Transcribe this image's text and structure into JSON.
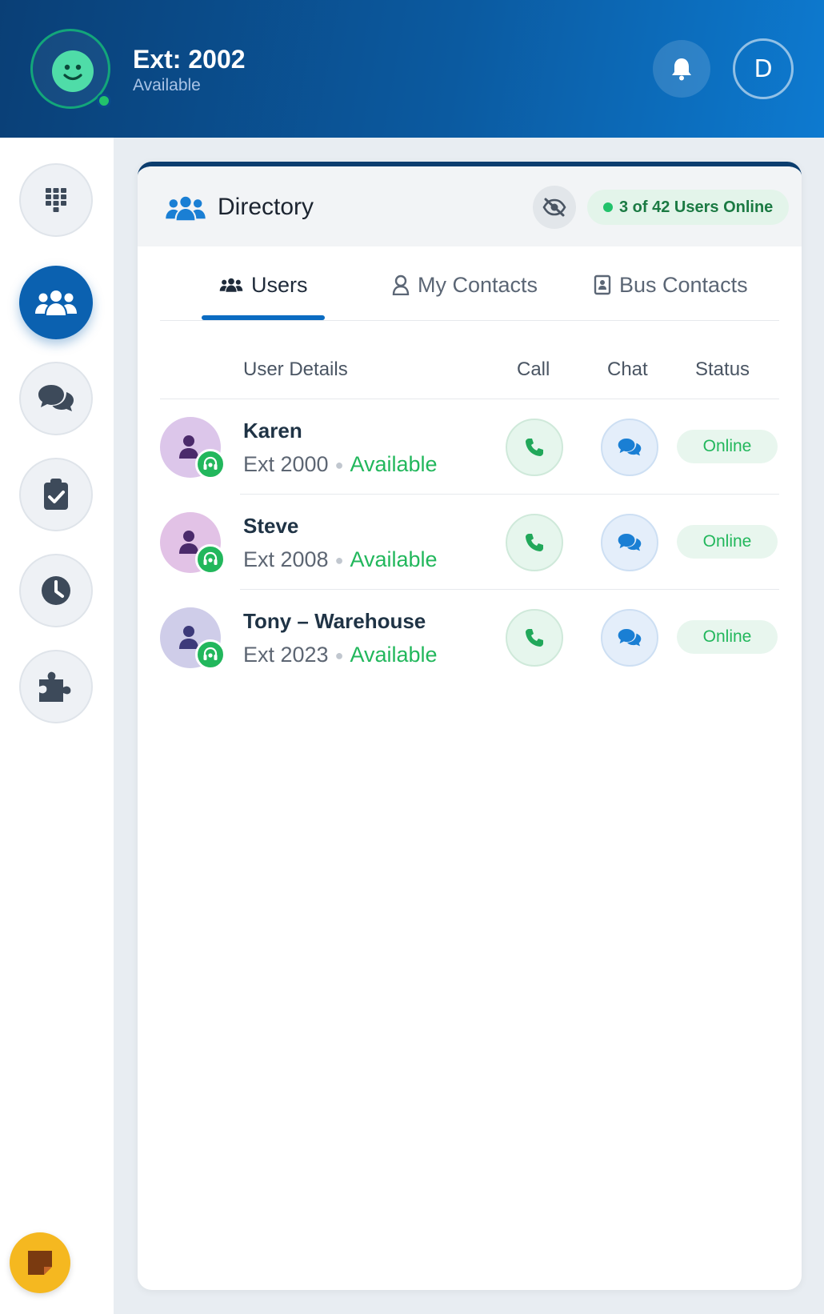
{
  "header": {
    "extension": "Ext: 2002",
    "presence": "Available",
    "avatar_initial": "D",
    "brand_color": "#0b5aa0"
  },
  "sidebar": {
    "items": [
      {
        "name": "dialpad",
        "icon": "dialpad-icon"
      },
      {
        "name": "directory",
        "icon": "users-icon",
        "active": true
      },
      {
        "name": "chat",
        "icon": "chat-bubbles-icon"
      },
      {
        "name": "tasks",
        "icon": "clipboard-check-icon"
      },
      {
        "name": "history",
        "icon": "clock-icon"
      },
      {
        "name": "integrations",
        "icon": "puzzle-icon"
      }
    ],
    "sticky_note_icon": "sticky-note-icon"
  },
  "directory": {
    "title": "Directory",
    "online_summary": "3 of 42 Users Online",
    "tabs": [
      {
        "label": "Users",
        "active": true
      },
      {
        "label": "My Contacts",
        "active": false
      },
      {
        "label": "Bus Contacts",
        "active": false
      }
    ],
    "columns": {
      "user_details": "User Details",
      "call": "Call",
      "chat": "Chat",
      "status": "Status"
    },
    "users": [
      {
        "name": "Karen",
        "ext": "Ext 2000",
        "presence": "Available",
        "status": "Online",
        "avatar_color": "#dcc6ea"
      },
      {
        "name": "Steve",
        "ext": "Ext 2008",
        "presence": "Available",
        "status": "Online",
        "avatar_color": "#e2c2e6"
      },
      {
        "name": "Tony – Warehouse",
        "ext": "Ext 2023",
        "presence": "Available",
        "status": "Online",
        "avatar_color": "#cfcde9"
      }
    ]
  }
}
